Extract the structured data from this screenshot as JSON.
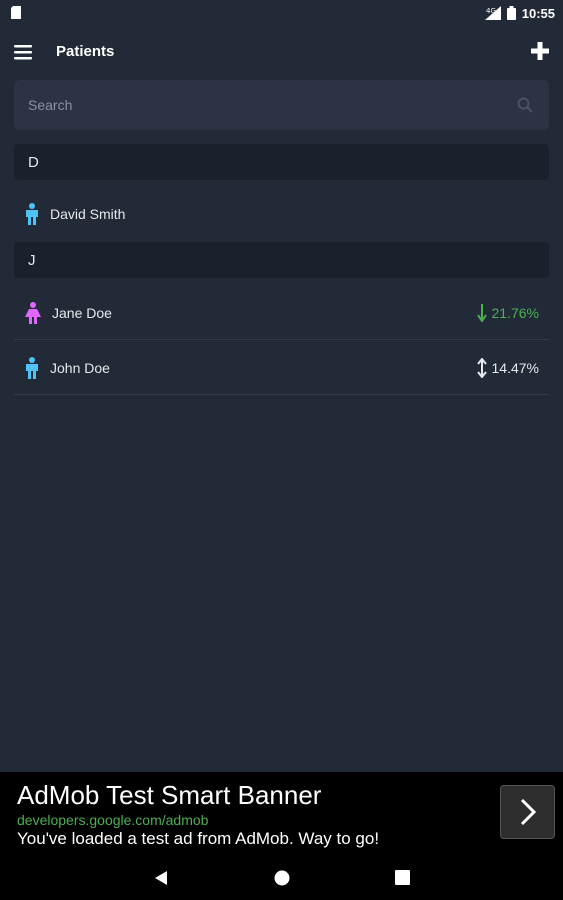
{
  "status_bar": {
    "time": "10:55",
    "left_icon": "sd-card-icon",
    "right_icons": [
      "signal-icon",
      "battery-icon"
    ]
  },
  "app_bar": {
    "title": "Patients",
    "menu_icon": "hamburger-menu-icon",
    "add_icon": "plus-icon"
  },
  "search": {
    "placeholder": "Search",
    "value": ""
  },
  "sections": [
    {
      "letter": "D",
      "patients": [
        {
          "name": "David Smith",
          "gender": "male",
          "change": "",
          "trend": ""
        }
      ]
    },
    {
      "letter": "J",
      "patients": [
        {
          "name": "Jane Doe",
          "gender": "female",
          "change": "21.76%",
          "trend": "down"
        },
        {
          "name": "John Doe",
          "gender": "male",
          "change": "14.47%",
          "trend": "neutral"
        }
      ]
    }
  ],
  "ad": {
    "title": "AdMob Test Smart Banner",
    "url": "developers.google.com/admob",
    "text": "You've loaded a test ad from AdMob. Way to go!"
  },
  "colors": {
    "background": "#222a38",
    "male": "#4fc3f7",
    "female": "#e066ff",
    "trend_down": "#4caf50",
    "trend_neutral": "#e6e8ec"
  }
}
